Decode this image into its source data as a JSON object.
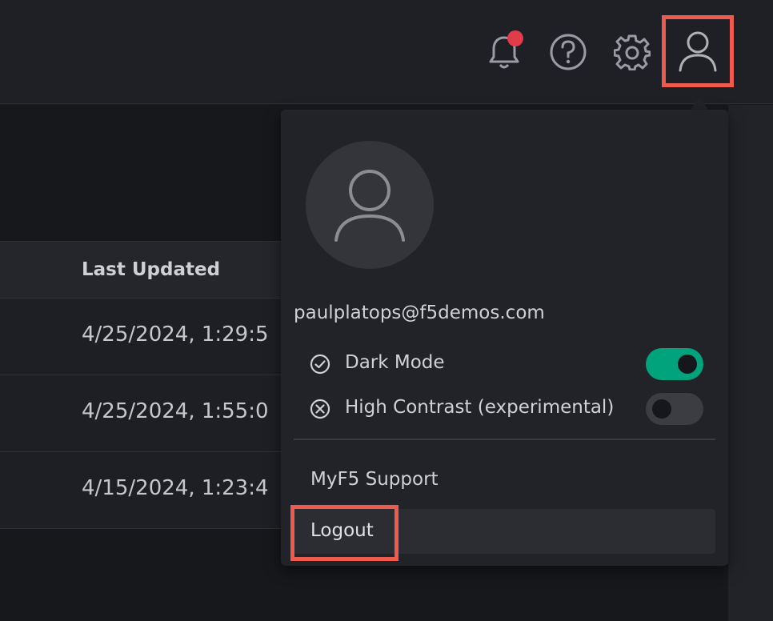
{
  "header": {
    "icons": [
      "bell-icon",
      "help-icon",
      "gear-icon",
      "user-icon"
    ],
    "notification_badge_color": "#e23c4a"
  },
  "table": {
    "column_header": "Last Updated",
    "rows": [
      "4/25/2024, 1:29:5",
      "4/25/2024, 1:55:0",
      "4/15/2024, 1:23:4"
    ]
  },
  "user_menu": {
    "email": "paulplatops@f5demos.com",
    "dark_mode": {
      "label": "Dark Mode",
      "enabled": true
    },
    "high_contrast": {
      "label": "High Contrast (experimental)",
      "enabled": false
    },
    "support_label": "MyF5 Support",
    "logout_label": "Logout"
  },
  "colors": {
    "accent": "#00a37b",
    "highlight": "#ee5a4e"
  }
}
